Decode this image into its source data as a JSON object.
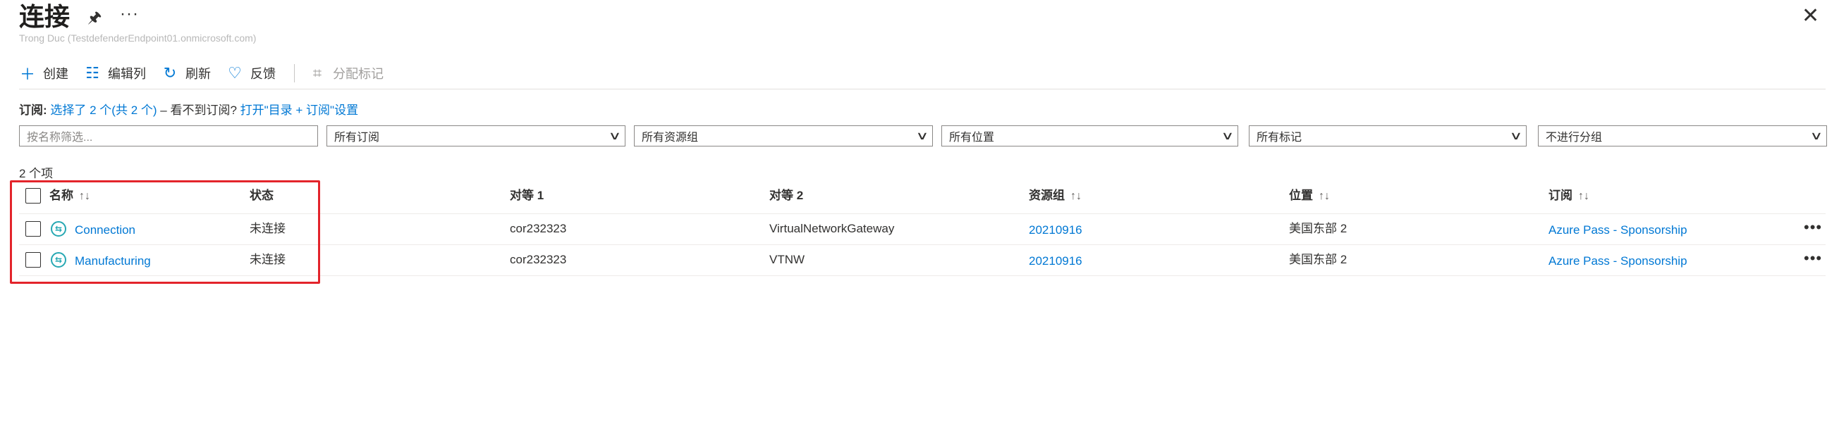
{
  "header": {
    "title": "连接",
    "subtitle": "Trong Duc (TestdefenderEndpoint01.onmicrosoft.com)",
    "pin_icon": "pin-icon",
    "more_icon": "more-icon",
    "close_icon": "close-icon"
  },
  "toolbar": {
    "create": "创建",
    "edit_columns": "编辑列",
    "refresh": "刷新",
    "feedback": "反馈",
    "assign_tags": "分配标记"
  },
  "subscription_line": {
    "label": "订阅:",
    "selected": "选择了 2 个(共 2 个)",
    "missing": "– 看不到订阅?",
    "open_link": "打开\"目录 + 订阅\"设置"
  },
  "filters": {
    "name_placeholder": "按名称筛选...",
    "subscription": "所有订阅",
    "resource_group": "所有资源组",
    "location": "所有位置",
    "tags": "所有标记",
    "grouping": "不进行分组"
  },
  "item_count": "2 个项",
  "table": {
    "columns": {
      "name": "名称",
      "status": "状态",
      "peer1": "对等 1",
      "peer2": "对等 2",
      "resource_group": "资源组",
      "location": "位置",
      "subscription": "订阅"
    },
    "sort_glyph": "↑↓",
    "rows": [
      {
        "name": "Connection",
        "status": "未连接",
        "peer1": "cor232323",
        "peer2": "VirtualNetworkGateway",
        "resource_group": "20210916",
        "location": "美国东部 2",
        "subscription": "Azure Pass - Sponsorship",
        "more": "•••"
      },
      {
        "name": "Manufacturing",
        "status": "未连接",
        "peer1": "cor232323",
        "peer2": "VTNW",
        "resource_group": "20210916",
        "location": "美国东部 2",
        "subscription": "Azure Pass - Sponsorship",
        "more": "•••"
      }
    ]
  },
  "colors": {
    "accent": "#0078d4",
    "highlight_box": "#e3242b",
    "connection_icon": "#27a8b3"
  }
}
